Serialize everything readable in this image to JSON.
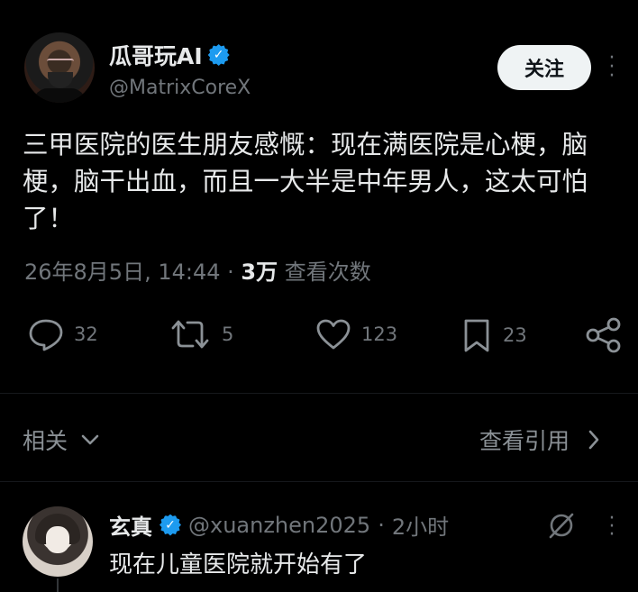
{
  "tweet": {
    "author_name": "瓜哥玩AI",
    "author_handle": "@MatrixCoreX",
    "follow_label": "关注",
    "text": "三甲医院的医生朋友感慨：现在满医院是心梗，脑梗，脑干出血，而且一大半是中年男人，这太可怕了！",
    "timestamp": "26年8月5日, 14:44",
    "separator": "·",
    "views_count": "3万",
    "views_label": "查看次数"
  },
  "actions": {
    "replies": "32",
    "retweets": "5",
    "likes": "123",
    "bookmarks": "23"
  },
  "section": {
    "related_label": "相关",
    "view_quotes_label": "查看引用"
  },
  "reply": {
    "author_name": "玄真",
    "author_handle": "@xuanzhen2025",
    "separator": "·",
    "time_ago": "2小时",
    "text": "现在儿童医院就开始有了"
  },
  "icons": {
    "verified": "verified-badge-icon",
    "more": "more-vertical-icon",
    "reply": "comment-bubble-icon",
    "retweet": "retweet-icon",
    "like": "heart-icon",
    "bookmark": "bookmark-icon",
    "share": "share-icon",
    "chevron_down": "chevron-down-icon",
    "chevron_right": "chevron-right-icon",
    "grok": "grok-icon"
  },
  "colors": {
    "background": "#000000",
    "text_primary": "#e7e9ea",
    "text_secondary": "#71767b",
    "verified": "#1d9bf0",
    "follow_button_bg": "#eff3f4"
  }
}
